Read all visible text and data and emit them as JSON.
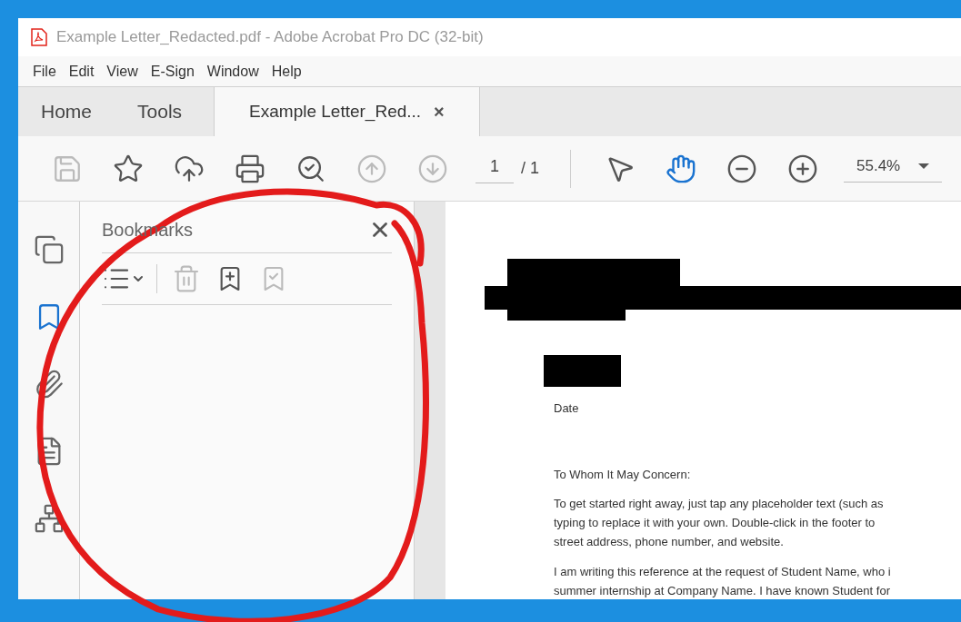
{
  "window": {
    "title": "Example Letter_Redacted.pdf - Adobe Acrobat Pro DC (32-bit)"
  },
  "menu": [
    "File",
    "Edit",
    "View",
    "E-Sign",
    "Window",
    "Help"
  ],
  "tabs": [
    {
      "label": "Home",
      "selected": false
    },
    {
      "label": "Tools",
      "selected": false
    },
    {
      "label": "Example Letter_Red...",
      "selected": true,
      "close": "×"
    }
  ],
  "toolbar": {
    "tools": [
      {
        "kind": "save",
        "disabled": true,
        "selected": false
      },
      {
        "kind": "star",
        "disabled": false,
        "selected": false
      },
      {
        "kind": "upload",
        "disabled": false,
        "selected": false
      },
      {
        "kind": "print",
        "disabled": false,
        "selected": false
      },
      {
        "kind": "find",
        "disabled": false,
        "selected": false
      },
      {
        "kind": "prev",
        "disabled": true,
        "selected": false
      },
      {
        "kind": "next",
        "disabled": true,
        "selected": false
      }
    ],
    "page": "1",
    "page_total": "/ 1",
    "nav_tools": [
      {
        "kind": "select",
        "selected": false
      },
      {
        "kind": "hand",
        "selected": true
      },
      {
        "kind": "zoom_out",
        "selected": false
      },
      {
        "kind": "zoom_in",
        "selected": false
      }
    ],
    "zoom": "55.4%"
  },
  "rail": [
    {
      "kind": "pages",
      "selected": false
    },
    {
      "kind": "bookmarks",
      "selected": true
    },
    {
      "kind": "attachments",
      "selected": false
    },
    {
      "kind": "page",
      "selected": false
    },
    {
      "kind": "structure",
      "selected": false
    }
  ],
  "bookmarks_panel": {
    "title": "Bookmarks",
    "tools": [
      {
        "kind": "options",
        "disabled": false
      },
      {
        "kind": "delete",
        "disabled": true
      },
      {
        "kind": "new",
        "disabled": false
      },
      {
        "kind": "from_selection",
        "disabled": true
      }
    ]
  },
  "document": {
    "date": "Date",
    "salutation": "To Whom It May Concern:",
    "paragraphs": [
      [
        "To get started right away, just tap any placeholder text (such as",
        "typing to replace it with your own. Double-click in the footer to",
        "street address, phone number, and website."
      ],
      [
        "I am writing this reference at the request of Student Name, who i",
        "summer internship at Company Name. I have known Student for"
      ]
    ]
  }
}
